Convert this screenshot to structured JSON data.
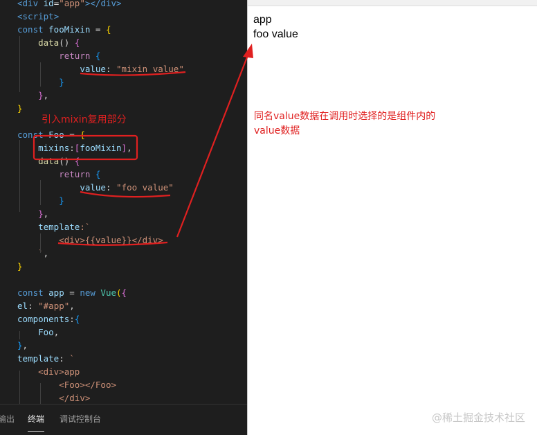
{
  "editor": {
    "lines": [
      [
        [
          "<",
          "tag"
        ],
        [
          "div ",
          "tag"
        ],
        [
          "id",
          "attr"
        ],
        [
          "=",
          "punc"
        ],
        [
          "\"app\"",
          "str"
        ],
        [
          "></",
          "tag"
        ],
        [
          "div",
          "tag"
        ],
        [
          ">",
          "tag"
        ]
      ],
      [
        [
          "<",
          "tag"
        ],
        [
          "script",
          "tag"
        ],
        [
          ">",
          "tag"
        ]
      ],
      [
        [
          "const ",
          "kw"
        ],
        [
          "fooMixin",
          "var"
        ],
        [
          " = ",
          "punc"
        ],
        [
          "{",
          "brace"
        ]
      ],
      [
        [
          "    ",
          "punc"
        ],
        [
          "data",
          "fn"
        ],
        [
          "() ",
          "punc"
        ],
        [
          "{",
          "brace2"
        ]
      ],
      [
        [
          "        ",
          "punc"
        ],
        [
          "return ",
          "ctrl"
        ],
        [
          "{",
          "brace3"
        ]
      ],
      [
        [
          "            ",
          "punc"
        ],
        [
          "value",
          "var"
        ],
        [
          ": ",
          "punc"
        ],
        [
          "\"mixin value\"",
          "str"
        ]
      ],
      [
        [
          "        ",
          "punc"
        ],
        [
          "}",
          "brace3"
        ]
      ],
      [
        [
          "    ",
          "punc"
        ],
        [
          "}",
          "brace2"
        ],
        [
          ",",
          "punc"
        ]
      ],
      [
        [
          "}",
          "brace"
        ]
      ],
      [
        [
          "",
          "punc"
        ]
      ],
      [
        [
          "const ",
          "kw"
        ],
        [
          "Foo",
          "var"
        ],
        [
          " = ",
          "punc"
        ],
        [
          "{",
          "brace"
        ]
      ],
      [
        [
          "    ",
          "punc"
        ],
        [
          "mixins",
          "var"
        ],
        [
          ":",
          "punc"
        ],
        [
          "[",
          "brace2"
        ],
        [
          "fooMixin",
          "var"
        ],
        [
          "]",
          "brace2"
        ],
        [
          ",",
          "punc"
        ]
      ],
      [
        [
          "    ",
          "punc"
        ],
        [
          "data",
          "fn"
        ],
        [
          "() ",
          "punc"
        ],
        [
          "{",
          "brace2"
        ]
      ],
      [
        [
          "        ",
          "punc"
        ],
        [
          "return ",
          "ctrl"
        ],
        [
          "{",
          "brace3"
        ]
      ],
      [
        [
          "            ",
          "punc"
        ],
        [
          "value",
          "var"
        ],
        [
          ": ",
          "punc"
        ],
        [
          "\"foo value\"",
          "str"
        ]
      ],
      [
        [
          "        ",
          "punc"
        ],
        [
          "}",
          "brace3"
        ]
      ],
      [
        [
          "    ",
          "punc"
        ],
        [
          "}",
          "brace2"
        ],
        [
          ",",
          "punc"
        ]
      ],
      [
        [
          "    ",
          "punc"
        ],
        [
          "template",
          "var"
        ],
        [
          ":`",
          "str"
        ]
      ],
      [
        [
          "        ",
          "punc"
        ],
        [
          "<div>{{value}}</div>",
          "str"
        ]
      ],
      [
        [
          "    ",
          "punc"
        ],
        [
          "`",
          "str"
        ],
        [
          ",",
          "punc"
        ]
      ],
      [
        [
          "}",
          "brace"
        ]
      ],
      [
        [
          "",
          "punc"
        ]
      ],
      [
        [
          "const ",
          "kw"
        ],
        [
          "app",
          "var"
        ],
        [
          " = ",
          "punc"
        ],
        [
          "new ",
          "kw"
        ],
        [
          "Vue",
          "cls"
        ],
        [
          "(",
          "brace"
        ],
        [
          "{",
          "brace2"
        ]
      ],
      [
        [
          "el",
          "var"
        ],
        [
          ": ",
          "punc"
        ],
        [
          "\"#app\"",
          "str"
        ],
        [
          ",",
          "punc"
        ]
      ],
      [
        [
          "components",
          "var"
        ],
        [
          ":",
          "punc"
        ],
        [
          "{",
          "brace3"
        ]
      ],
      [
        [
          "    ",
          "punc"
        ],
        [
          "Foo",
          "var"
        ],
        [
          ",",
          "punc"
        ]
      ],
      [
        [
          "}",
          "brace3"
        ],
        [
          ",",
          "punc"
        ]
      ],
      [
        [
          "template",
          "var"
        ],
        [
          ": ",
          "punc"
        ],
        [
          "`",
          "str"
        ]
      ],
      [
        [
          "    ",
          "punc"
        ],
        [
          "<div>app",
          "str"
        ]
      ],
      [
        [
          "        ",
          "punc"
        ],
        [
          "<Foo></Foo>",
          "str"
        ]
      ],
      [
        [
          "        ",
          "punc"
        ],
        [
          "</div>",
          "str"
        ]
      ]
    ],
    "annotation_label": "引入mixin复用部分"
  },
  "panel": {
    "tabs": [
      "输出",
      "终端",
      "调试控制台"
    ],
    "active": 1
  },
  "browser": {
    "line1": "app",
    "line2": "foo value",
    "annotation": "同名value数据在调用时选择的是组件内的value数据"
  },
  "watermark": "@稀土掘金技术社区",
  "colors": {
    "annotation_red": "#e02020",
    "editor_bg": "#1e1e1e"
  }
}
